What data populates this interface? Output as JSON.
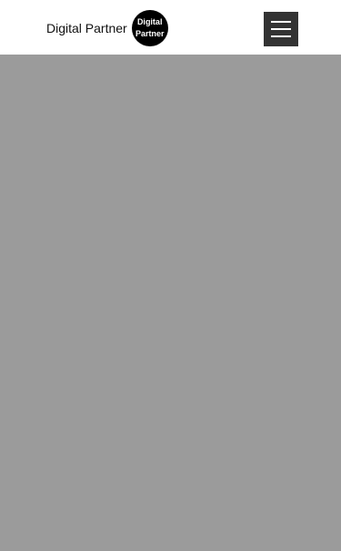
{
  "header": {
    "brand_text": "Digital Partner",
    "badge_line1": "Digital",
    "badge_line2": "Partner",
    "menu_icon": "hamburger-menu-icon"
  },
  "colors": {
    "header_bg": "#ffffff",
    "badge_bg": "#000000",
    "menu_button_bg": "#333333",
    "overlay_bg": "#9b9b9b"
  }
}
